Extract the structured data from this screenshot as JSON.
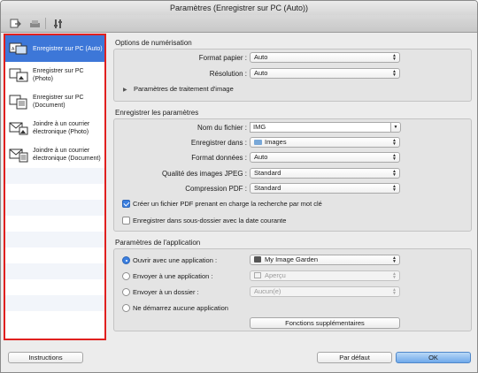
{
  "window": {
    "title": "Paramètres (Enregistrer sur PC (Auto))"
  },
  "toolbar": {
    "icons": [
      "scan-from-computer-icon",
      "scan-from-operation-panel-icon",
      "general-settings-icon"
    ]
  },
  "sidebar": {
    "items": [
      {
        "label": "Enregistrer sur PC (Auto)",
        "icon": "auto-save-icon",
        "selected": true
      },
      {
        "label_line1": "Enregistrer sur PC",
        "label_line2": "(Photo)",
        "icon": "photo-save-icon"
      },
      {
        "label_line1": "Enregistrer sur PC",
        "label_line2": "(Document)",
        "icon": "document-save-icon"
      },
      {
        "label_line1": "Joindre à un courrier",
        "label_line2": "électronique (Photo)",
        "icon": "mail-photo-icon"
      },
      {
        "label_line1": "Joindre à un courrier",
        "label_line2": "électronique (Document)",
        "icon": "mail-document-icon"
      }
    ]
  },
  "scan_options": {
    "title": "Options de numérisation",
    "paper_size_label": "Format papier :",
    "paper_size_value": "Auto",
    "resolution_label": "Résolution :",
    "resolution_value": "Auto",
    "image_processing_label": "Paramètres de traitement d'image"
  },
  "save_settings": {
    "title": "Enregistrer les paramètres",
    "filename_label": "Nom du fichier :",
    "filename_value": "IMG",
    "save_in_label": "Enregistrer dans :",
    "save_in_value": "Images",
    "data_format_label": "Format données :",
    "data_format_value": "Auto",
    "jpeg_quality_label": "Qualité des images JPEG :",
    "jpeg_quality_value": "Standard",
    "pdf_compression_label": "Compression PDF :",
    "pdf_compression_value": "Standard",
    "searchable_pdf_label": "Créer un fichier PDF prenant en charge la recherche par mot clé",
    "searchable_pdf_checked": true,
    "subfolder_label": "Enregistrer dans sous-dossier avec la date courante",
    "subfolder_checked": false
  },
  "app_settings": {
    "title": "Paramètres de l'application",
    "open_app_label": "Ouvrir avec une application :",
    "open_app_value": "My Image Garden",
    "send_app_label": "Envoyer à une application :",
    "send_app_value": "Aperçu",
    "send_folder_label": "Envoyer à un dossier :",
    "send_folder_value": "Aucun(e)",
    "no_app_label": "Ne démarrez aucune application",
    "more_functions_label": "Fonctions supplémentaires",
    "selected_option": "open_app"
  },
  "footer": {
    "instructions_label": "Instructions",
    "defaults_label": "Par défaut",
    "ok_label": "OK"
  }
}
